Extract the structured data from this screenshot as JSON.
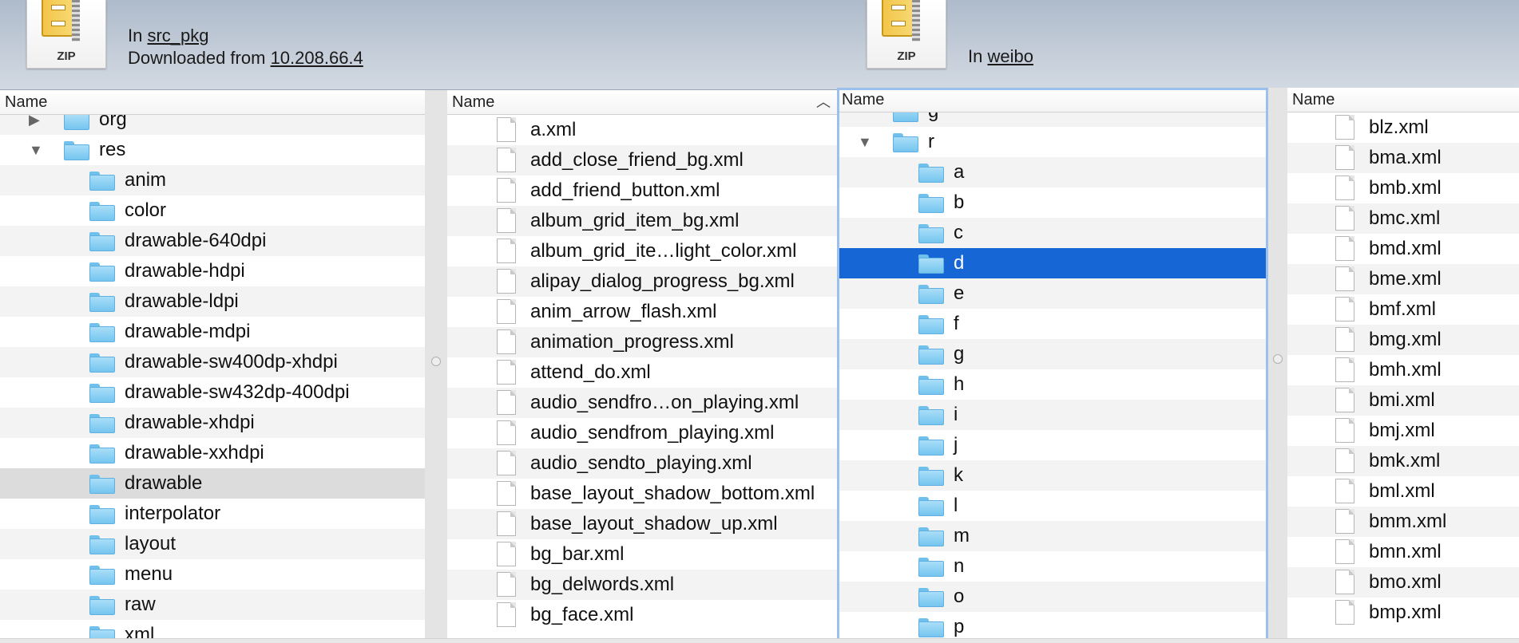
{
  "left_window": {
    "zip_label": "ZIP",
    "location_prefix": "In",
    "location": "src_pkg",
    "download_prefix": "Downloaded from",
    "download_source": "10.208.66.4",
    "tree_header": "Name",
    "tree_rows": [
      {
        "label": "org",
        "kind": "folder",
        "level": 0,
        "disclosure": "▶",
        "partial": true
      },
      {
        "label": "res",
        "kind": "folder",
        "level": 0,
        "disclosure": "▼"
      },
      {
        "label": "anim",
        "kind": "folder",
        "level": 1
      },
      {
        "label": "color",
        "kind": "folder",
        "level": 1
      },
      {
        "label": "drawable-640dpi",
        "kind": "folder",
        "level": 1
      },
      {
        "label": "drawable-hdpi",
        "kind": "folder",
        "level": 1
      },
      {
        "label": "drawable-ldpi",
        "kind": "folder",
        "level": 1
      },
      {
        "label": "drawable-mdpi",
        "kind": "folder",
        "level": 1
      },
      {
        "label": "drawable-sw400dp-xhdpi",
        "kind": "folder",
        "level": 1
      },
      {
        "label": "drawable-sw432dp-400dpi",
        "kind": "folder",
        "level": 1
      },
      {
        "label": "drawable-xhdpi",
        "kind": "folder",
        "level": 1
      },
      {
        "label": "drawable-xxhdpi",
        "kind": "folder",
        "level": 1
      },
      {
        "label": "drawable",
        "kind": "folder",
        "level": 1,
        "selected": "inactive"
      },
      {
        "label": "interpolator",
        "kind": "folder",
        "level": 1
      },
      {
        "label": "layout",
        "kind": "folder",
        "level": 1
      },
      {
        "label": "menu",
        "kind": "folder",
        "level": 1
      },
      {
        "label": "raw",
        "kind": "folder",
        "level": 1
      },
      {
        "label": "xml",
        "kind": "folder",
        "level": 1,
        "partial": true
      }
    ],
    "files_header": "Name",
    "files": [
      "a.xml",
      "add_close_friend_bg.xml",
      "add_friend_button.xml",
      "album_grid_item_bg.xml",
      "album_grid_ite…light_color.xml",
      "alipay_dialog_progress_bg.xml",
      "anim_arrow_flash.xml",
      "animation_progress.xml",
      "attend_do.xml",
      "audio_sendfro…on_playing.xml",
      "audio_sendfrom_playing.xml",
      "audio_sendto_playing.xml",
      "base_layout_shadow_bottom.xml",
      "base_layout_shadow_up.xml",
      "bg_bar.xml",
      "bg_delwords.xml",
      "bg_face.xml"
    ]
  },
  "right_window": {
    "zip_label": "ZIP",
    "location_prefix": "In",
    "location": "weibo",
    "tree_header": "Name",
    "tree_rows": [
      {
        "label": "g",
        "kind": "folder",
        "level": 1,
        "partial": true
      },
      {
        "label": "r",
        "kind": "folder",
        "level": 1,
        "disclosure": "▼"
      },
      {
        "label": "a",
        "kind": "folder",
        "level": 2
      },
      {
        "label": "b",
        "kind": "folder",
        "level": 2
      },
      {
        "label": "c",
        "kind": "folder",
        "level": 2
      },
      {
        "label": "d",
        "kind": "folder",
        "level": 2,
        "selected": "active"
      },
      {
        "label": "e",
        "kind": "folder",
        "level": 2
      },
      {
        "label": "f",
        "kind": "folder",
        "level": 2
      },
      {
        "label": "g",
        "kind": "folder",
        "level": 2
      },
      {
        "label": "h",
        "kind": "folder",
        "level": 2
      },
      {
        "label": "i",
        "kind": "folder",
        "level": 2
      },
      {
        "label": "j",
        "kind": "folder",
        "level": 2
      },
      {
        "label": "k",
        "kind": "folder",
        "level": 2
      },
      {
        "label": "l",
        "kind": "folder",
        "level": 2
      },
      {
        "label": "m",
        "kind": "folder",
        "level": 2
      },
      {
        "label": "n",
        "kind": "folder",
        "level": 2
      },
      {
        "label": "o",
        "kind": "folder",
        "level": 2
      },
      {
        "label": "p",
        "kind": "folder",
        "level": 2
      }
    ],
    "files_header": "Name",
    "files": [
      "blz.xml",
      "bma.xml",
      "bmb.xml",
      "bmc.xml",
      "bmd.xml",
      "bme.xml",
      "bmf.xml",
      "bmg.xml",
      "bmh.xml",
      "bmi.xml",
      "bmj.xml",
      "bmk.xml",
      "bml.xml",
      "bmm.xml",
      "bmn.xml",
      "bmo.xml",
      "bmp.xml"
    ]
  },
  "icons": {
    "archive": "zip-archive-icon",
    "folder": "folder-icon",
    "file": "document-icon",
    "expand": "disclosure-triangle-icon",
    "sort": "sort-ascending-icon"
  },
  "colors": {
    "selection_active": "#1667d5",
    "selection_inactive": "#dcdcdc",
    "folder": "#75c5ef",
    "header_bg": "#c3ccd8"
  }
}
